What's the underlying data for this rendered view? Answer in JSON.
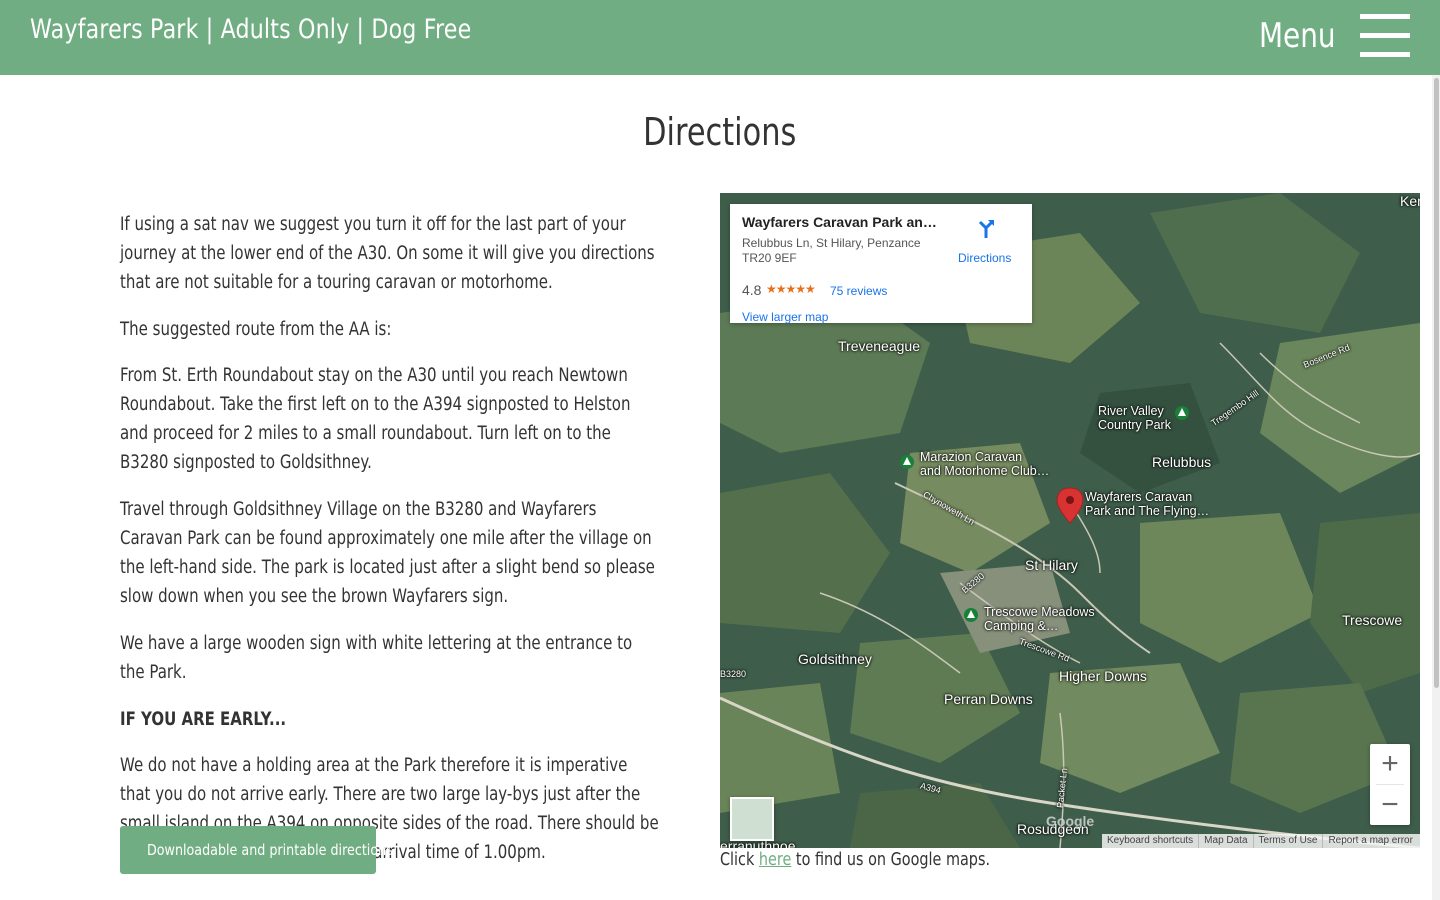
{
  "header": {
    "title": "Wayfarers Park  |  Adults Only  |  Dog Free",
    "menu_label": "Menu"
  },
  "page": {
    "title": "Directions"
  },
  "content": {
    "paragraphs": [
      "If using a sat nav we suggest you turn it off for the last part of your journey at the lower end of the A30. On some it will give you directions that are not suitable for a touring caravan or motorhome.",
      "The suggested route from the AA is:",
      "From St. Erth Roundabout stay on the A30 until you reach Newtown Roundabout. Take the first left on to the A394 signposted to Helston and proceed for 2 miles to a small roundabout. Turn left on to the B3280 signposted to Goldsithney.",
      "Travel through Goldsithney Village on the B3280 and Wayfarers Caravan Park can be found approximately one mile after the village on the left-hand side. The park is located just after a slight bend so please slow down when you see the brown Wayfarers sign.",
      "We have a large wooden sign with white lettering at the entrance to the Park."
    ],
    "early_heading": "IF YOU ARE EARLY...",
    "early_paragraph": "We do not have a holding area at the Park therefore it is imperative that you do not arrive early.  There are two large lay-bys just after the small island on the A394 on opposite sides of the road.  There should be ample room to park up until your arrival time of 1.00pm.",
    "download_button": "Downloadable and printable directions"
  },
  "map": {
    "card": {
      "name": "Wayfarers Caravan Park and T…",
      "address": "Relubbus Ln, St Hilary, Penzance TR20 9EF",
      "rating": "4.8",
      "stars": "★★★★★",
      "reviews": "75 reviews",
      "larger_map": "View larger map",
      "directions": "Directions"
    },
    "labels": {
      "treveneague": "Treveneague",
      "river_valley": "River Valley\nCountry Park",
      "relubbus": "Relubbus",
      "marazion": "Marazion Caravan\nand Motorhome Club…",
      "wayfarers": "Wayfarers Caravan\nPark and The Flying…",
      "st_hilary": "St Hilary",
      "trescowe_meadows": "Trescowe Meadows\nCamping &…",
      "trescowe": "Trescowe",
      "goldsithney": "Goldsithney",
      "higher_downs": "Higher Downs",
      "perran_downs": "Perran Downs",
      "rosudgeon": "Rosudgeon",
      "perranuthnoe": "erranuthnoe",
      "ken": "Ken",
      "bosence_rd": "Bosence Rd",
      "tregembo_hill": "Tregembo Hill",
      "chynoweth_ln": "Chynoweth Ln",
      "b3280_a": "B3280",
      "b3280_b": "B3280",
      "trescowe_rd": "Trescowe Rd",
      "a394": "A394",
      "packet_ln": "Packet Ln",
      "google": "Google"
    },
    "zoom_in": "+",
    "zoom_out": "−",
    "footer": [
      "Keyboard shortcuts",
      "Map Data",
      "Terms of Use",
      "Report a map error"
    ]
  },
  "footer_line": {
    "before": "Click ",
    "link": "here",
    "after": " to find us on Google maps."
  },
  "colors": {
    "brand_green": "#71ad82",
    "link_blue": "#1a73e8",
    "pin_red": "#d93232"
  }
}
